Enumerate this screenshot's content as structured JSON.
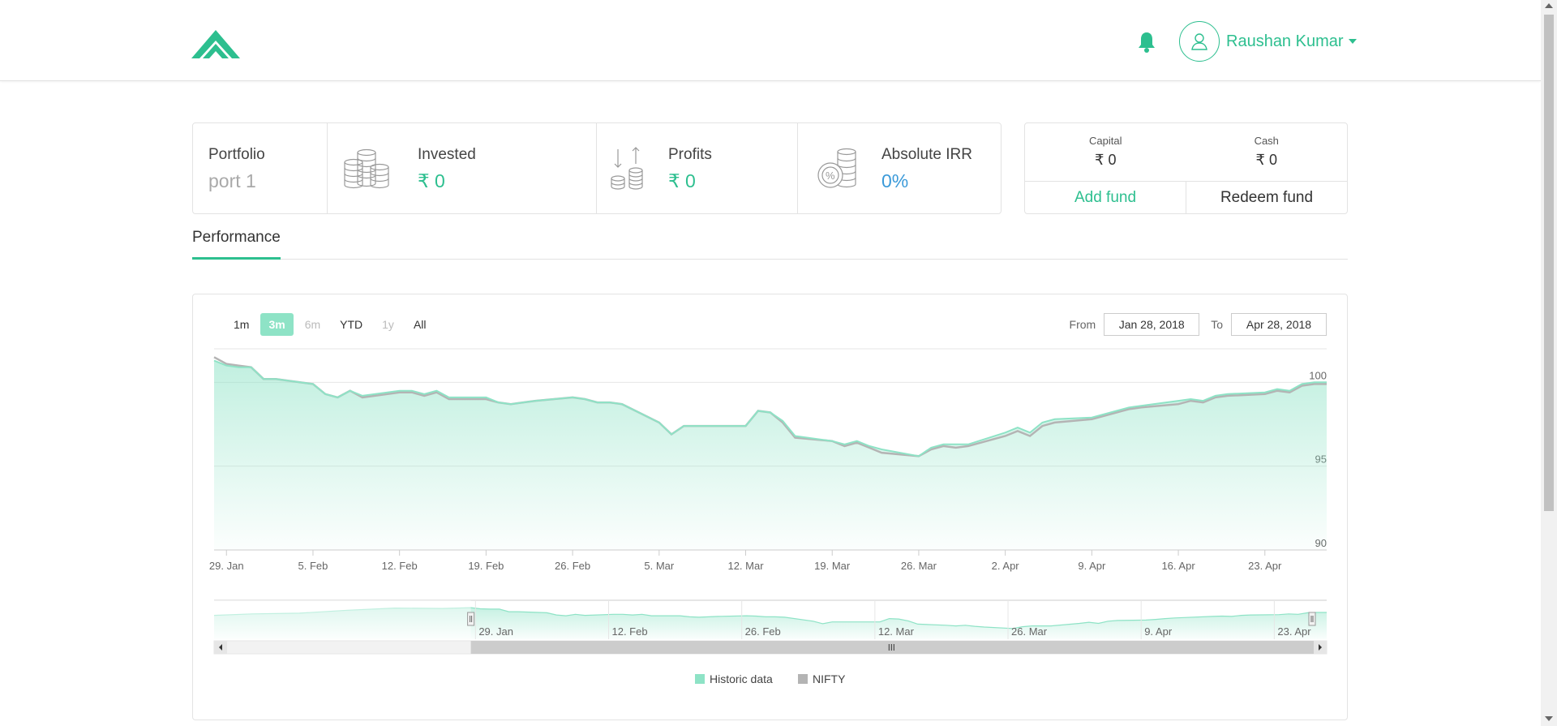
{
  "header": {
    "user_name": "Raushan Kumar"
  },
  "stats": {
    "portfolio_label": "Portfolio",
    "portfolio_value": "port 1",
    "invested_label": "Invested",
    "invested_value": "₹ 0",
    "profits_label": "Profits",
    "profits_value": "₹ 0",
    "irr_label": "Absolute IRR",
    "irr_value": "0%"
  },
  "fund": {
    "capital_label": "Capital",
    "capital_value": "₹ 0",
    "cash_label": "Cash",
    "cash_value": "₹ 0",
    "add_label": "Add fund",
    "redeem_label": "Redeem fund"
  },
  "tabs": {
    "performance": "Performance"
  },
  "range_buttons": [
    "1m",
    "3m",
    "6m",
    "YTD",
    "1y",
    "All"
  ],
  "range_active": "3m",
  "range_disabled": [
    "6m",
    "1y"
  ],
  "dates": {
    "from_label": "From",
    "from_value": "Jan 28, 2018",
    "to_label": "To",
    "to_value": "Apr 28, 2018"
  },
  "colors": {
    "accent": "#2dbf8f",
    "series_historic": "#8ee3c6",
    "series_nifty": "#b4b4b4",
    "irr_blue": "#3b9ad9"
  },
  "chart_data": {
    "type": "line",
    "x_start": "2018-01-28",
    "x_end": "2018-04-28",
    "ylim": [
      90,
      102
    ],
    "y_ticks": [
      90,
      95,
      100
    ],
    "x_ticks": [
      "29. Jan",
      "5. Feb",
      "12. Feb",
      "19. Feb",
      "26. Feb",
      "5. Mar",
      "12. Mar",
      "19. Mar",
      "26. Mar",
      "2. Apr",
      "9. Apr",
      "16. Apr",
      "23. Apr"
    ],
    "x_tick_dates": [
      "2018-01-29",
      "2018-02-05",
      "2018-02-12",
      "2018-02-19",
      "2018-02-26",
      "2018-03-05",
      "2018-03-12",
      "2018-03-19",
      "2018-03-26",
      "2018-04-02",
      "2018-04-09",
      "2018-04-16",
      "2018-04-23"
    ],
    "dates": [
      "2018-01-28",
      "2018-01-29",
      "2018-01-30",
      "2018-01-31",
      "2018-02-01",
      "2018-02-02",
      "2018-02-05",
      "2018-02-06",
      "2018-02-07",
      "2018-02-08",
      "2018-02-09",
      "2018-02-12",
      "2018-02-13",
      "2018-02-14",
      "2018-02-15",
      "2018-02-16",
      "2018-02-19",
      "2018-02-20",
      "2018-02-21",
      "2018-02-22",
      "2018-02-23",
      "2018-02-26",
      "2018-02-27",
      "2018-02-28",
      "2018-03-01",
      "2018-03-02",
      "2018-03-05",
      "2018-03-06",
      "2018-03-07",
      "2018-03-08",
      "2018-03-09",
      "2018-03-12",
      "2018-03-13",
      "2018-03-14",
      "2018-03-15",
      "2018-03-16",
      "2018-03-19",
      "2018-03-20",
      "2018-03-21",
      "2018-03-22",
      "2018-03-23",
      "2018-03-26",
      "2018-03-27",
      "2018-03-28",
      "2018-03-29",
      "2018-03-30",
      "2018-04-02",
      "2018-04-03",
      "2018-04-04",
      "2018-04-05",
      "2018-04-06",
      "2018-04-09",
      "2018-04-10",
      "2018-04-11",
      "2018-04-12",
      "2018-04-13",
      "2018-04-16",
      "2018-04-17",
      "2018-04-18",
      "2018-04-19",
      "2018-04-20",
      "2018-04-23",
      "2018-04-24",
      "2018-04-25",
      "2018-04-26",
      "2018-04-27",
      "2018-04-28"
    ],
    "series": [
      {
        "name": "Historic data",
        "values": [
          101.3,
          101.0,
          100.9,
          100.9,
          100.2,
          100.2,
          99.9,
          99.3,
          99.1,
          99.5,
          99.2,
          99.5,
          99.5,
          99.3,
          99.5,
          99.1,
          99.1,
          98.8,
          98.7,
          98.8,
          98.9,
          99.1,
          99.0,
          98.8,
          98.8,
          98.7,
          97.6,
          96.9,
          97.4,
          97.4,
          97.4,
          97.4,
          98.3,
          98.2,
          97.7,
          96.8,
          96.5,
          96.3,
          96.5,
          96.2,
          96.0,
          95.6,
          96.1,
          96.3,
          96.3,
          96.3,
          97.0,
          97.3,
          97.0,
          97.6,
          97.8,
          97.9,
          98.1,
          98.3,
          98.5,
          98.6,
          98.9,
          99.0,
          98.9,
          99.2,
          99.3,
          99.4,
          99.6,
          99.5,
          99.9,
          100.0,
          100.0
        ],
        "color": "#8ee3c6"
      },
      {
        "name": "NIFTY",
        "values": [
          101.5,
          101.1,
          101.0,
          100.9,
          100.2,
          100.2,
          99.9,
          99.3,
          99.1,
          99.5,
          99.1,
          99.4,
          99.4,
          99.2,
          99.4,
          99.0,
          99.0,
          98.8,
          98.7,
          98.8,
          98.9,
          99.1,
          99.0,
          98.8,
          98.8,
          98.7,
          97.6,
          96.9,
          97.4,
          97.4,
          97.4,
          97.4,
          98.3,
          98.2,
          97.6,
          96.7,
          96.5,
          96.2,
          96.4,
          96.1,
          95.8,
          95.6,
          96.0,
          96.2,
          96.1,
          96.2,
          96.8,
          97.1,
          96.8,
          97.4,
          97.6,
          97.8,
          98.0,
          98.2,
          98.4,
          98.5,
          98.7,
          98.9,
          98.8,
          99.1,
          99.2,
          99.3,
          99.5,
          99.4,
          99.8,
          99.9,
          99.9
        ],
        "color": "#b4b4b4"
      }
    ],
    "navigator_ticks": [
      "29. Jan",
      "12. Feb",
      "26. Feb",
      "12. Mar",
      "26. Mar",
      "9. Apr",
      "23. Apr"
    ],
    "legend": [
      "Historic data",
      "NIFTY"
    ],
    "legend_position": "bottom-center",
    "grid": true
  }
}
